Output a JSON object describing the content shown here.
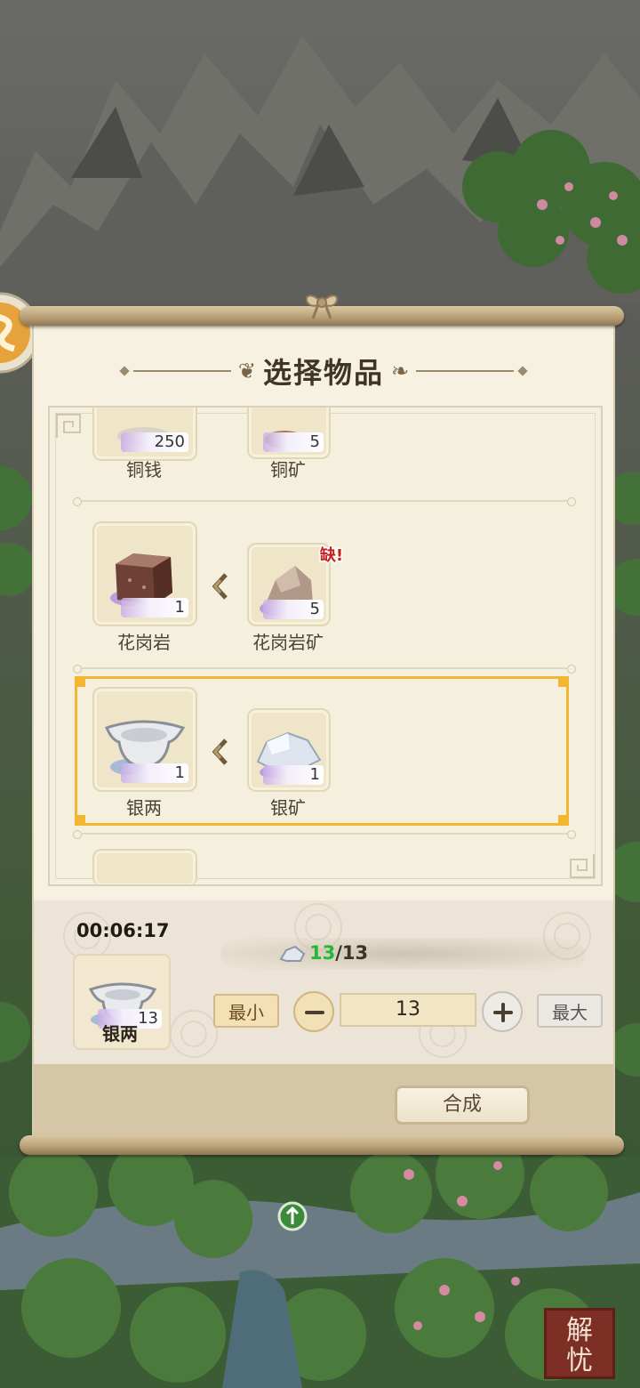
{
  "dialog": {
    "title": "选择物品"
  },
  "recipes": [
    {
      "output": {
        "name": "铜钱",
        "quantity": "250"
      },
      "input": {
        "name": "铜矿",
        "quantity": "5"
      },
      "partial": true
    },
    {
      "output": {
        "name": "花岗岩",
        "quantity": "1"
      },
      "input": {
        "name": "花岗岩矿",
        "quantity": "5",
        "missing_badge": "缺!"
      }
    },
    {
      "output": {
        "name": "银两",
        "quantity": "1"
      },
      "input": {
        "name": "银矿",
        "quantity": "1"
      },
      "selected": true
    }
  ],
  "craft": {
    "timer": "00:06:17",
    "item_name": "银两",
    "item_quantity": "13",
    "material_current": "13",
    "material_required": "/13",
    "min_label": "最小",
    "max_label": "最大",
    "amount": "13",
    "craft_label": "合成"
  },
  "seal_text": "解忧",
  "colors": {
    "selection": "#f2b630",
    "sufficient": "#22b833",
    "missing": "#c81d1d"
  },
  "icons": [
    "copper-coin-icon",
    "copper-ore-icon",
    "granite-block-icon",
    "granite-ore-icon",
    "silver-ingot-icon",
    "silver-ore-icon",
    "minus-icon",
    "plus-icon",
    "arrow-left-icon"
  ]
}
